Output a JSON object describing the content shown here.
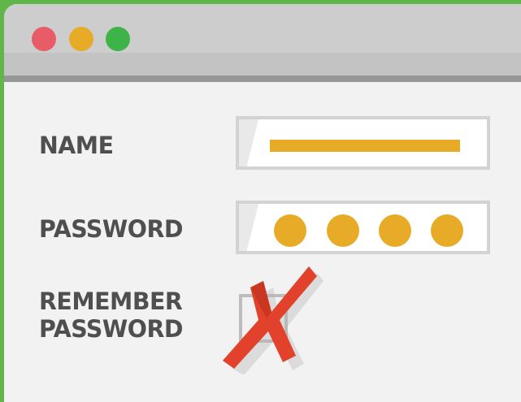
{
  "window": {
    "controls": {
      "close": "close-dot",
      "minimize": "minimize-dot",
      "maximize": "maximize-dot"
    }
  },
  "form": {
    "name": {
      "label": "NAME"
    },
    "password": {
      "label": "PASSWORD",
      "masked_dots": 4
    },
    "remember": {
      "label": "REMEMBER\nPASSWORD",
      "checked": false,
      "mark": "red-x-icon"
    }
  },
  "colors": {
    "frame": "#62b548",
    "accent": "#e8ab27",
    "close": "#e85c67",
    "maximize": "#3db44a",
    "label": "#4f4f4f",
    "x_mark": "#e2412b"
  }
}
